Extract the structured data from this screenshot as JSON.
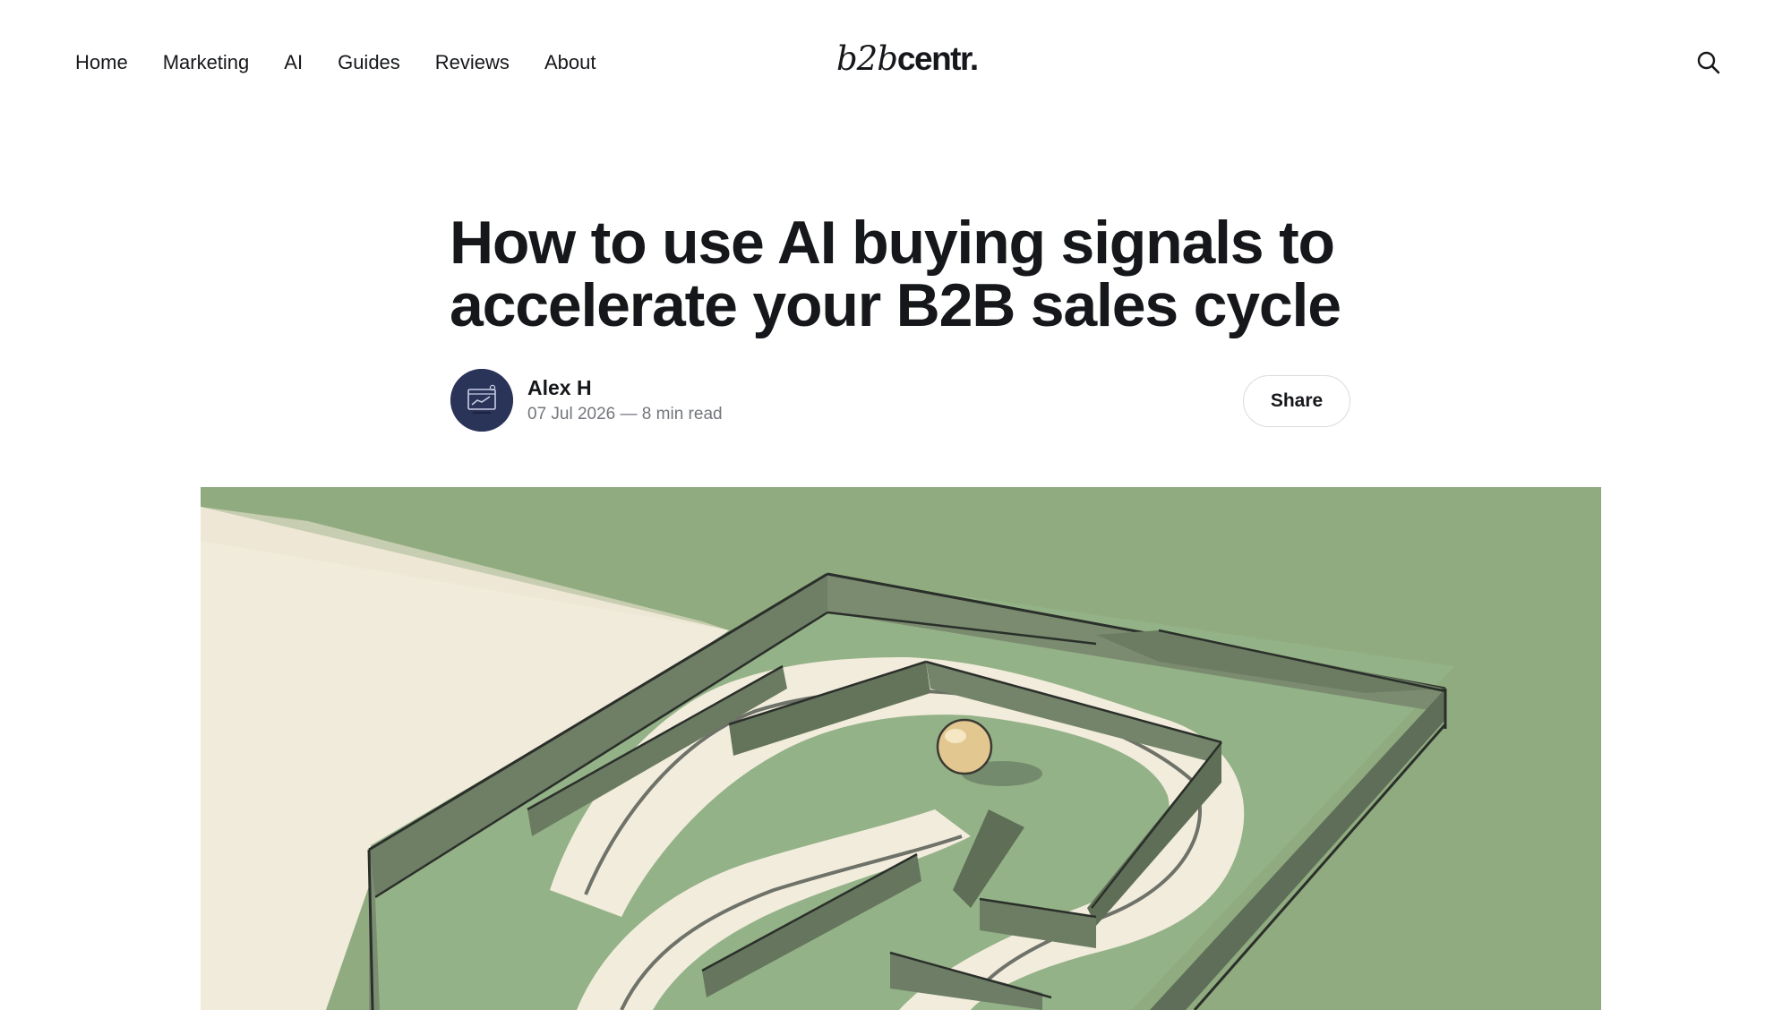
{
  "header": {
    "nav": [
      "Home",
      "Marketing",
      "AI",
      "Guides",
      "Reviews",
      "About"
    ],
    "logo": {
      "italic": "b2b",
      "bold": "centr."
    },
    "search_icon": "search-icon"
  },
  "article": {
    "title": "How to use AI buying signals to accelerate your B2B sales cycle",
    "author": "Alex H",
    "meta": "07 Jul 2026 — 8 min read",
    "share_label": "Share",
    "feature_image": "maze-illustration"
  },
  "colors": {
    "text": "#15171a",
    "muted": "#73767c",
    "image_green": "#8fab7f",
    "image_cream": "#f1ebdc",
    "avatar_bg": "#2a3358"
  }
}
